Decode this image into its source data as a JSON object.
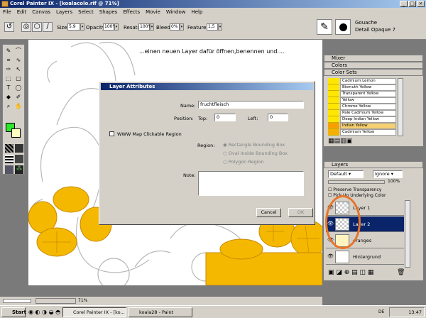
{
  "window": {
    "title": "Corel Painter IX - [koalacolo.rif @ 71%]",
    "min": "_",
    "max": "□",
    "close": "×"
  },
  "menu": [
    "File",
    "Edit",
    "Canvas",
    "Layers",
    "Select",
    "Shapes",
    "Effects",
    "Movie",
    "Window",
    "Help"
  ],
  "propbar": {
    "size_label": "Size:",
    "size_value": "5,9",
    "opacity_label": "Opacity:",
    "opacity_value": "100%",
    "resat_label": "Resat:",
    "resat_value": "100%",
    "bleed_label": "Bleed:",
    "bleed_value": "0%",
    "feature_label": "Feature:",
    "feature_value": "1,5",
    "brush_category": "Gouache",
    "brush_variant": "Detail Opaque 7"
  },
  "caption": "...einen neuen Layer dafür öffnen,benennen und....",
  "dialog": {
    "title": "Layer Attributes",
    "name_label": "Name:",
    "name_value": "fruchtfleisch",
    "position_label": "Position:",
    "top_label": "Top:",
    "top_value": "0",
    "left_label": "Left:",
    "left_value": "0",
    "www_label": "WWW Map Clickable Region",
    "region_label": "Region:",
    "region_options": [
      "Rectangle Bounding Box",
      "Oval Inside Bounding Box",
      "Polygon Region"
    ],
    "note_label": "Note:",
    "cancel": "Cancel",
    "ok": "OK"
  },
  "panels": {
    "mixer": "Mixer",
    "colors": "Colors",
    "color_sets": "Color Sets",
    "layers": "Layers"
  },
  "colorset": [
    "Cadmium Lemon",
    "Bismuth Yellow",
    "Transparent Yellow",
    "Yellow",
    "Chrome Yellow",
    "Pale Cadmium Yellow",
    "Deep Indian Yellow",
    "Indian Yellow",
    "Cadmium Yellow"
  ],
  "layers": {
    "composite": "Default",
    "method": "Ignore",
    "opacity": "100%",
    "preserve": "Preserve Transparency",
    "pickup": "Pick Up Underlying Color",
    "items": [
      "Layer 1",
      "Layer 2",
      "oranges",
      "Hintergrund"
    ]
  },
  "status": {
    "zoom": "71%"
  },
  "taskbar": {
    "start": "Start",
    "tasks": [
      "Corel Painter IX - [ko...",
      "koala28 - Paint"
    ],
    "lang": "DE",
    "time": "13:47"
  },
  "colors": {
    "accent": "#0a246a",
    "fruit": "#f5b800",
    "highlight_circle": "#e8742a"
  }
}
